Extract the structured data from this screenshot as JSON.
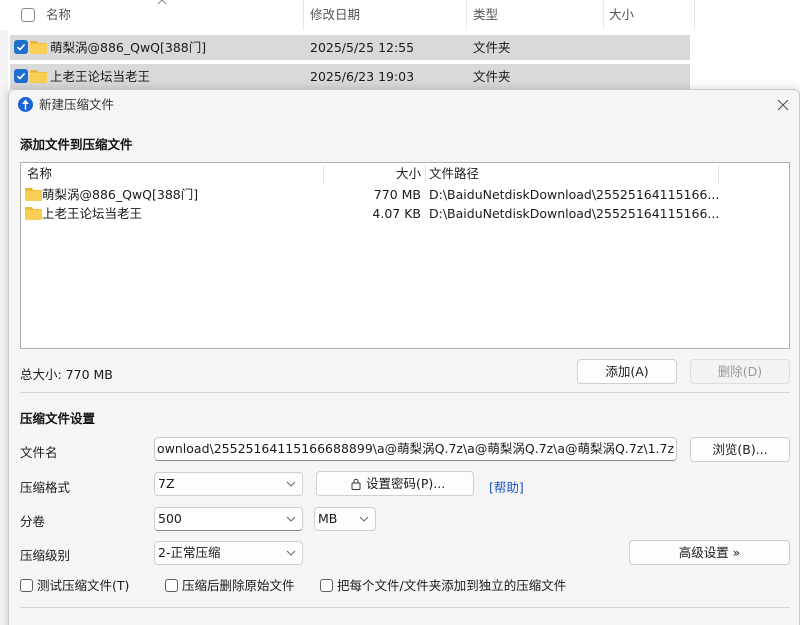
{
  "explorer": {
    "columns": {
      "name": "名称",
      "modified": "修改日期",
      "type": "类型",
      "size": "大小"
    },
    "rows": [
      {
        "name": "萌梨涡@886_QwQ[388门]",
        "date": "2025/5/25 12:55",
        "type": "文件夹",
        "checked": true
      },
      {
        "name": "上老王论坛当老王",
        "date": "2025/6/23 19:03",
        "type": "文件夹",
        "checked": true
      }
    ]
  },
  "dialog": {
    "title": "新建压缩文件",
    "add_section_title": "添加文件到压缩文件",
    "file_list": {
      "columns": {
        "name": "名称",
        "size": "大小",
        "path": "文件路径"
      },
      "rows": [
        {
          "name": "萌梨涡@886_QwQ[388门]",
          "size": "770 MB",
          "path": "D:\\BaiduNetdiskDownload\\25525164115166..."
        },
        {
          "name": "上老王论坛当老王",
          "size": "4.07 KB",
          "path": "D:\\BaiduNetdiskDownload\\25525164115166..."
        }
      ]
    },
    "total_size": "总大小: 770 MB",
    "add_button": "添加(A)",
    "delete_button": "删除(D)",
    "settings_title": "压缩文件设置",
    "filename_label": "文件名",
    "filename_value": "ownload\\25525164115166688899\\a@萌梨涡Q.7z\\a@萌梨涡Q.7z\\a@萌梨涡Q.7z\\1.7z",
    "browse_button": "浏览(B)...",
    "format_label": "压缩格式",
    "format_value": "7Z",
    "password_button": "设置密码(P)...",
    "help_link": "[帮助]",
    "split_label": "分卷",
    "split_value": "500",
    "split_unit": "MB",
    "level_label": "压缩级别",
    "level_value": "2-正常压缩",
    "advanced_button": "高级设置 »",
    "options": {
      "test": "测试压缩文件(T)",
      "delete_after": "压缩后删除原始文件",
      "separate": "把每个文件/文件夹添加到独立的压缩文件"
    }
  },
  "colors": {
    "accent": "#1e6fd0",
    "selection": "#d9d9d9",
    "folder": "#f8cf54",
    "link": "#1a55c8"
  },
  "icons": [
    "checkbox-checked-icon",
    "folder-icon",
    "app-icon",
    "close-icon",
    "lock-icon",
    "chevron-down-icon"
  ]
}
